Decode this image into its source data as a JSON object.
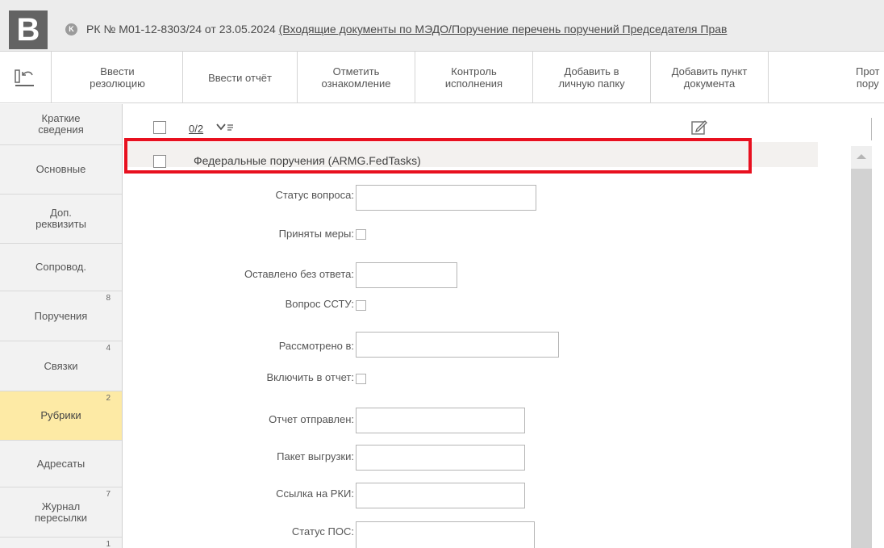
{
  "header": {
    "logo_letter": "B",
    "k_badge": "K",
    "doc_prefix": "РК № М01-12-8303/24 от 23.05.2024 ",
    "doc_link": "(Входящие документы по МЭДО/Поручение перечень поручений Председателя Прав"
  },
  "toolbar": {
    "buttons": [
      {
        "label": "Ввести\nрезолюцию"
      },
      {
        "label": "Ввести отчёт"
      },
      {
        "label": "Отметить\nознакомление"
      },
      {
        "label": "Контроль\nисполнения"
      },
      {
        "label": "Добавить в\nличную папку"
      },
      {
        "label": "Добавить пункт\nдокумента"
      },
      {
        "label": "Прот\nпору"
      }
    ]
  },
  "sidebar": {
    "items": [
      {
        "label": "Краткие\nсведения",
        "count": ""
      },
      {
        "label": "Основные",
        "count": ""
      },
      {
        "label": "Доп.\nреквизиты",
        "count": ""
      },
      {
        "label": "Сопровод.",
        "count": ""
      },
      {
        "label": "Поручения",
        "count": "8"
      },
      {
        "label": "Связки",
        "count": "4"
      },
      {
        "label": "Рубрики",
        "count": "2"
      },
      {
        "label": "Адресаты",
        "count": ""
      },
      {
        "label": "Журнал\nпересылки",
        "count": "7"
      },
      {
        "label": "",
        "count": "1"
      }
    ],
    "active_index": 6
  },
  "main": {
    "count_label": "0/2",
    "group_label": "Федеральные поручения (ARMG.FedTasks)",
    "fields": [
      {
        "label": "Статус вопроса:",
        "type": "text"
      },
      {
        "label": "Приняты меры:",
        "type": "checkbox"
      },
      {
        "label": "Оставлено без ответа:",
        "type": "text"
      },
      {
        "label": "Вопрос ССТУ:",
        "type": "checkbox"
      },
      {
        "label": "Рассмотрено в:",
        "type": "text"
      },
      {
        "label": "Включить в отчет:",
        "type": "checkbox"
      },
      {
        "label": "Отчет отправлен:",
        "type": "text"
      },
      {
        "label": "Пакет выгрузки:",
        "type": "text"
      },
      {
        "label": "Ссылка на РКИ:",
        "type": "text"
      },
      {
        "label": "Статус ПОС:",
        "type": "text"
      }
    ]
  },
  "colors": {
    "active_tab": "#fdeaa5",
    "highlight": "#e8101f"
  }
}
